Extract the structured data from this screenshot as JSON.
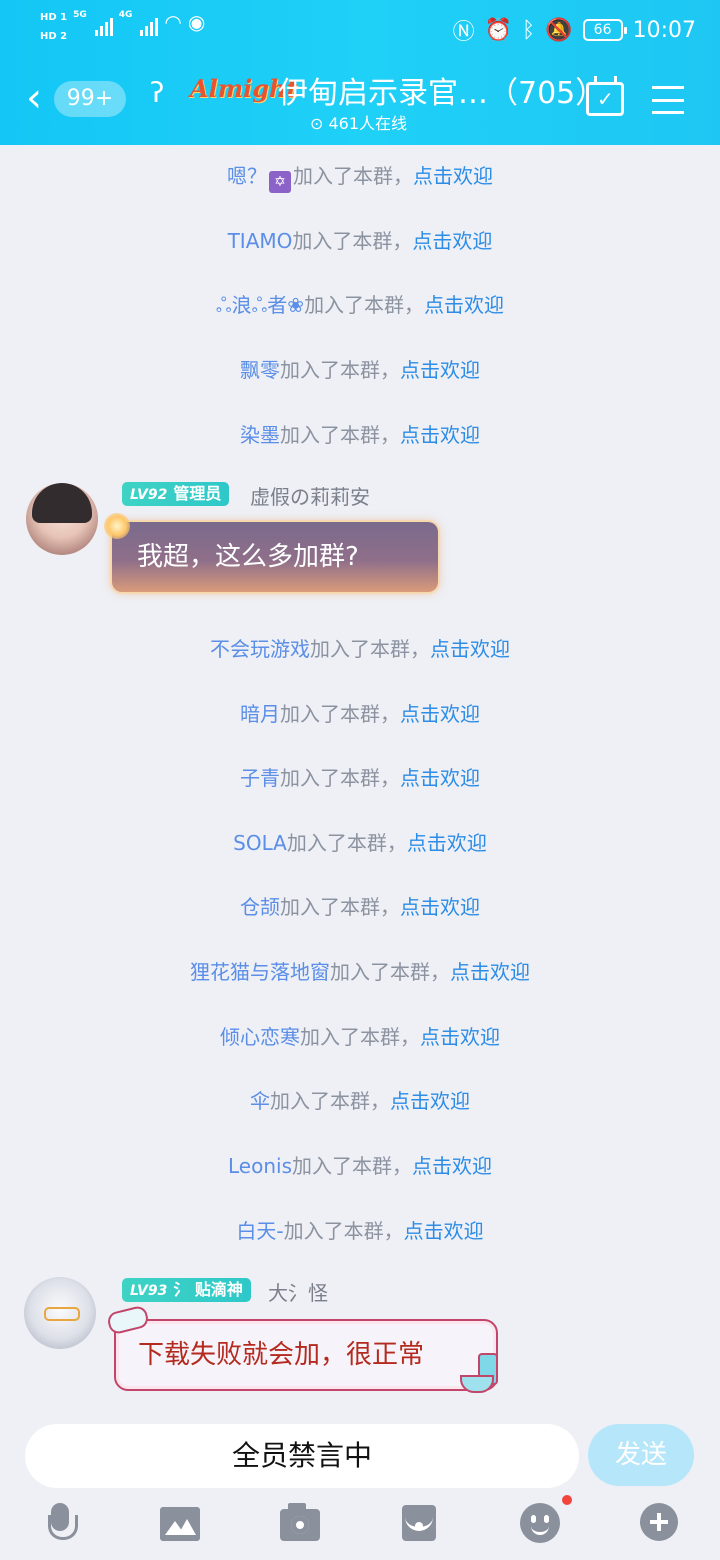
{
  "status": {
    "hd1": "HD 1",
    "hd2": "HD 2",
    "net1": "5G",
    "net2": "4G",
    "battery": "66",
    "time": "10:07"
  },
  "header": {
    "back_badge": "99+",
    "brand": "Almight",
    "title": "伊甸启示录官…（705）",
    "online": "461人在线"
  },
  "join_text": "加入了本群，",
  "welcome_text": "点击欢迎",
  "messages": {
    "j1_name": "嗯？",
    "j2_name": "TIAMO",
    "j3_name": "浪",
    "j3_name2": "者",
    "j4_name": "飘零",
    "j5_name": "染墨",
    "m1": {
      "level": "LV92",
      "role": "管理员",
      "sender": "虚假の莉莉安",
      "text": "我超，这么多加群?"
    },
    "j6_name": "不会玩游戏",
    "j7_name": "暗月",
    "j8_name": "子青",
    "j9_name": "SOLA",
    "j10_name": "仓颉",
    "j11_name": "狸花猫与落地窗",
    "j12_name": "倾心恋寒",
    "j13_name": "伞",
    "j14_name": "Leonis",
    "j15_name": "白天-",
    "m2": {
      "level": "LV93",
      "role": "贴滴神",
      "sender": "大氵怪",
      "text": "下载失败就会加，很正常"
    }
  },
  "input": {
    "placeholder": "全员禁言中",
    "send": "发送"
  },
  "colors": {
    "header": "#13c6f5",
    "link": "#2c8ce6",
    "level_tag": "#3fd3c5"
  }
}
